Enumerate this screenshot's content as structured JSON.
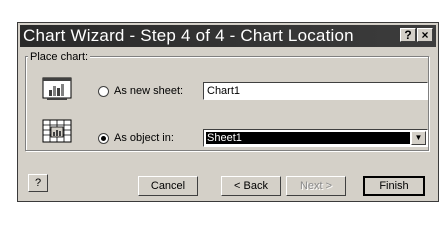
{
  "dialog": {
    "title": "Chart Wizard - Step 4 of 4 - Chart Location",
    "help_glyph": "?",
    "close_glyph": "×"
  },
  "place_chart": {
    "label": "Place chart:",
    "new_sheet_label": "As new sheet:",
    "new_sheet_value": "Chart1",
    "object_in_label": "As object in:",
    "object_in_value": "Sheet1",
    "selected": "As object in"
  },
  "buttons": {
    "help": "?",
    "cancel": "Cancel",
    "back": "< Back",
    "next": "Next >",
    "finish": "Finish"
  },
  "colors": {
    "dialog_bg": "#d4d0c8",
    "titlebar": "#333333",
    "selection": "#000000"
  },
  "icons": [
    "new-sheet-chart-icon",
    "embedded-chart-icon",
    "help-icon",
    "close-icon",
    "dropdown-arrow-icon"
  ]
}
